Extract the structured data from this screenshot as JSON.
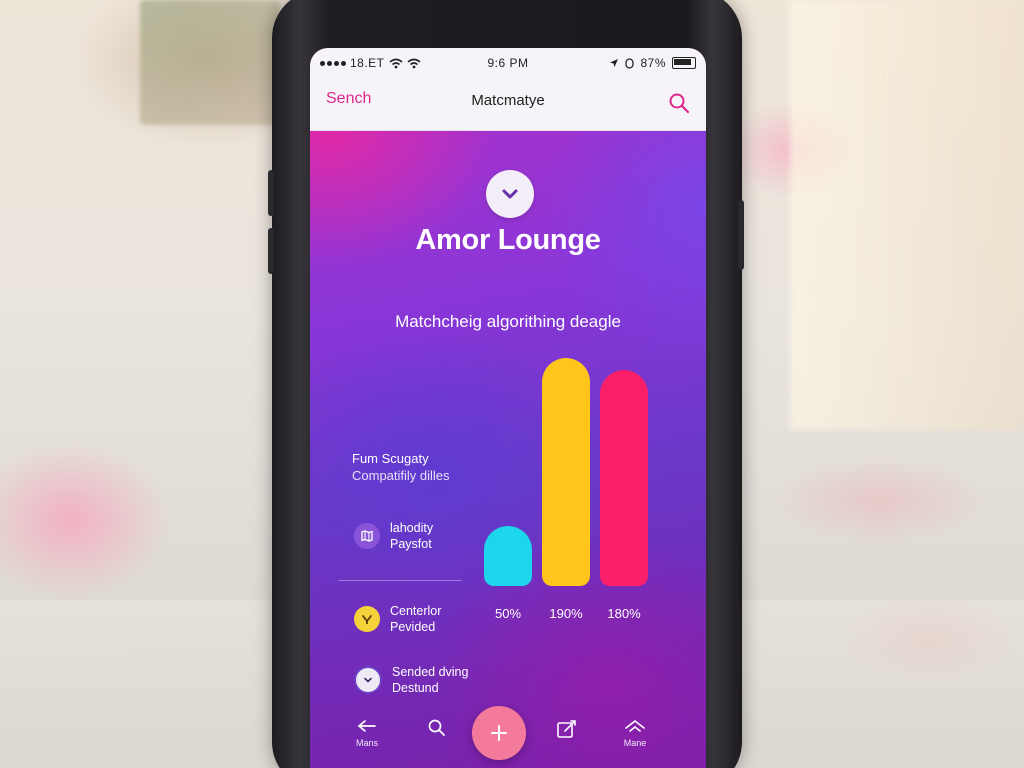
{
  "status_bar": {
    "carrier": "18.ET",
    "time": "9:6 PM",
    "battery": "87%"
  },
  "nav": {
    "left_label": "Sench",
    "title": "Matcmatye"
  },
  "app_title": "Amor Lounge",
  "section_title": "Matchcheig algorithing deagle",
  "sidebar": {
    "heading": "Fum Scugaty",
    "subheading": "Compatifily dilles"
  },
  "legend": [
    {
      "line1": "lahodity",
      "line2": "Paysfot",
      "icon": "map-icon",
      "color": "#8a54d8"
    },
    {
      "line1": "Centerlor",
      "line2": "Pevided",
      "icon": "location-pin-icon",
      "color": "#f6d23a"
    },
    {
      "line1": "Sended dving",
      "line2": "Destund",
      "icon": "chevron-down-icon",
      "color": "#efe9f6"
    }
  ],
  "chart_data": {
    "type": "bar",
    "categories": [
      "",
      "",
      ""
    ],
    "values": [
      50,
      190,
      180
    ],
    "value_labels": [
      "50%",
      "190%",
      "180%"
    ],
    "colors": [
      "#1ed6ec",
      "#ffc51a",
      "#fb1f6a"
    ]
  },
  "tab_bar": {
    "items": [
      {
        "label": "Mans",
        "icon": "back-arrow-icon"
      },
      {
        "label": "",
        "icon": "search-icon"
      },
      {
        "label": "",
        "icon": "plus-icon"
      },
      {
        "label": "",
        "icon": "edit-icon"
      },
      {
        "label": "Mane",
        "icon": "home-icon"
      }
    ]
  },
  "colors": {
    "accent": "#e0288e",
    "fab": "#f47a9c"
  }
}
